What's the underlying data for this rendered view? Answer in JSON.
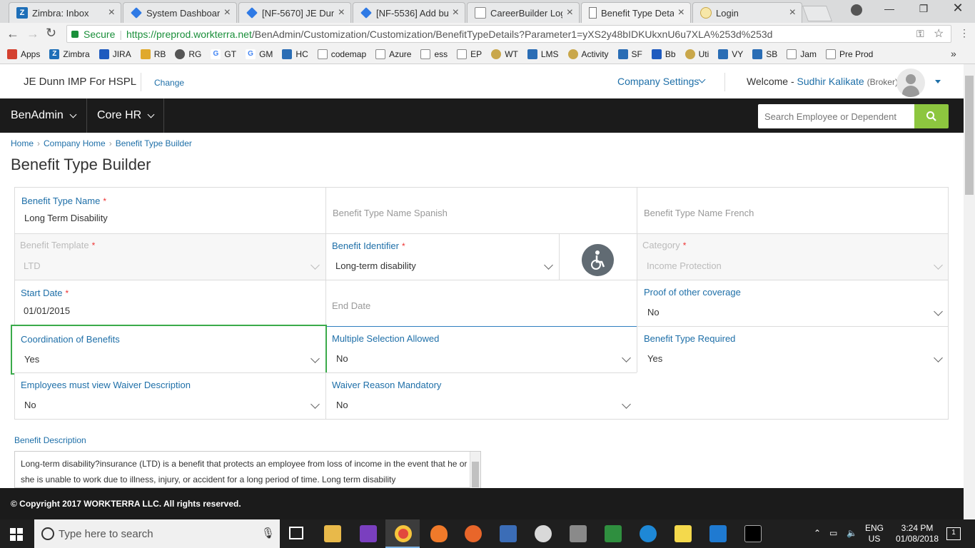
{
  "browser": {
    "tabs": [
      {
        "title": "Zimbra: Inbox",
        "icon": "zimbra-icon"
      },
      {
        "title": "System Dashboard",
        "icon": "jira-icon"
      },
      {
        "title": "[NF-5670] JE Dunn",
        "icon": "jira-icon"
      },
      {
        "title": "[NF-5536] Add but",
        "icon": "jira-icon"
      },
      {
        "title": "CareerBuilder Logi",
        "icon": "careerbuilder-icon"
      },
      {
        "title": "Benefit Type Detai",
        "icon": "page-icon"
      },
      {
        "title": "Login",
        "icon": "login-icon"
      }
    ],
    "secure_label": "Secure",
    "url_host": "https://preprod.workterra.net",
    "url_path": "/BenAdmin/Customization/Customization/BenefitTypeDetails?Parameter1=yXS2y48bIDKUkxnU6u7XLA%253d%253d",
    "bookmarks": [
      "Apps",
      "Zimbra",
      "JIRA",
      "RB",
      "RG",
      "GT",
      "GM",
      "HC",
      "codemap",
      "Azure",
      "ess",
      "EP",
      "WT",
      "LMS",
      "Activity",
      "SF",
      "Bb",
      "Uti",
      "VY",
      "SB",
      "Jam",
      "Pre Prod"
    ],
    "bookmarks_more": "»"
  },
  "header": {
    "company": "JE Dunn IMP For HSPL",
    "change": "Change",
    "settings": "Company Settings",
    "welcome": "Welcome -",
    "user": "Sudhir Kalikate",
    "role": "(Broker)"
  },
  "nav": {
    "items": [
      "BenAdmin",
      "Core HR"
    ],
    "search_placeholder": "Search Employee or Dependent"
  },
  "breadcrumb": [
    "Home",
    "Company Home",
    "Benefit Type Builder"
  ],
  "page_title": "Benefit Type Builder",
  "form": {
    "benefit_type_name": {
      "label": "Benefit Type Name",
      "value": "Long Term Disability"
    },
    "name_spanish": {
      "placeholder": "Benefit Type Name Spanish"
    },
    "name_french": {
      "placeholder": "Benefit Type Name French"
    },
    "benefit_template": {
      "label": "Benefit Template",
      "value": "LTD"
    },
    "benefit_identifier": {
      "label": "Benefit Identifier",
      "value": "Long-term disability"
    },
    "category": {
      "label": "Category",
      "value": "Income Protection"
    },
    "start_date": {
      "label": "Start Date",
      "value": "01/01/2015"
    },
    "end_date": {
      "placeholder": "End Date"
    },
    "proof_of_coverage": {
      "label": "Proof of other coverage",
      "value": "No"
    },
    "coordination_of_benefits": {
      "label": "Coordination of Benefits",
      "value": "Yes"
    },
    "multiple_selection": {
      "label": "Multiple Selection Allowed",
      "value": "No"
    },
    "benefit_type_required": {
      "label": "Benefit Type Required",
      "value": "Yes"
    },
    "view_waiver": {
      "label": "Employees must view Waiver Description",
      "value": "No"
    },
    "waiver_mandatory": {
      "label": "Waiver Reason Mandatory",
      "value": "No"
    },
    "required_marker": "*"
  },
  "description": {
    "label": "Benefit Description",
    "text": "Long-term disability?insurance (LTD) is a benefit that protects an employee from loss of income in the event that he or she is unable to work due to illness, injury, or accident for a long period of time. Long term disability"
  },
  "footer": "© Copyright 2017 WORKTERRA LLC. All rights reserved.",
  "taskbar": {
    "search_placeholder": "Type here to search",
    "lang": "ENG",
    "region": "US",
    "time": "3:24 PM",
    "date": "01/08/2018",
    "notifications": "1"
  },
  "colors": {
    "accent": "#1e6fa8",
    "search_button": "#8dc63f",
    "focus_border": "#3aaa4a",
    "nav_bg": "#1b1b1b"
  }
}
